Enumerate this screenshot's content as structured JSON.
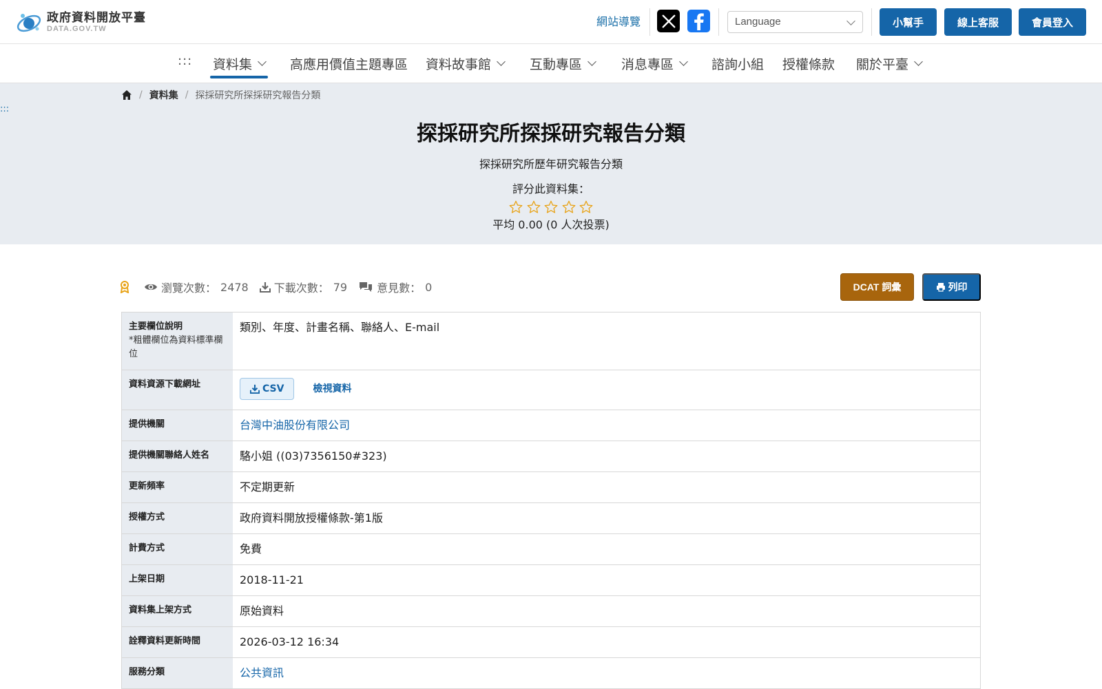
{
  "header": {
    "logo_title": "政府資料開放平臺",
    "logo_subtitle": "DATA.GOV.TW",
    "sitemap_label": "網站導覽",
    "language_placeholder": "Language",
    "helper_label": "小幫手",
    "service_label": "線上客服",
    "login_label": "會員登入"
  },
  "nav": {
    "accesskey": ":::",
    "items": [
      {
        "label": "資料集",
        "dropdown": true,
        "active": true
      },
      {
        "label": "高應用價值主題專區",
        "dropdown": false
      },
      {
        "label": "資料故事館",
        "dropdown": true
      },
      {
        "label": "互動專區",
        "dropdown": true
      },
      {
        "label": "消息專區",
        "dropdown": true
      },
      {
        "label": "諮詢小組",
        "dropdown": false
      },
      {
        "label": "授權條款",
        "dropdown": false
      },
      {
        "label": "關於平臺",
        "dropdown": true
      }
    ]
  },
  "breadcrumb": {
    "separator": "/",
    "section": "資料集",
    "current": "探採研究所探採研究報告分類"
  },
  "side_accesskey": ":::",
  "dataset": {
    "title": "探採研究所探採研究報告分類",
    "description": "探採研究所歷年研究報告分類",
    "rate_label": "評分此資料集：",
    "rating_value": 0,
    "rating_max": 5,
    "rating_summary": "平均 0.00 (0 人次投票)"
  },
  "stats": {
    "views_label": "瀏覽次數：",
    "views": "2478",
    "downloads_label": "下載次數：",
    "downloads": "79",
    "comments_label": "意見數：",
    "comments": "0"
  },
  "actions": {
    "dcat_label": "DCAT 詞彙",
    "print_label": "列印"
  },
  "meta": {
    "fields": {
      "key": "主要欄位說明",
      "note": "*粗體欄位為資料標準欄位",
      "value": "類別、年度、計畫名稱、聯絡人、E-mail"
    },
    "download": {
      "key": "資料資源下載網址",
      "csv_label": "CSV",
      "view_label": "檢視資料"
    },
    "rows": [
      {
        "key": "提供機關",
        "value": "台灣中油股份有限公司",
        "link": true
      },
      {
        "key": "提供機關聯絡人姓名",
        "value": "駱小姐 ((03)7356150#323)",
        "link": false
      },
      {
        "key": "更新頻率",
        "value": "不定期更新",
        "link": false
      },
      {
        "key": "授權方式",
        "value": "政府資料開放授權條款-第1版",
        "link": false
      },
      {
        "key": "計費方式",
        "value": "免費",
        "link": false
      },
      {
        "key": "上架日期",
        "value": "2018-11-21",
        "link": false
      },
      {
        "key": "資料集上架方式",
        "value": "原始資料",
        "link": false
      },
      {
        "key": "詮釋資料更新時間",
        "value": "2026-03-12 16:34",
        "link": false
      },
      {
        "key": "服務分類",
        "value": "公共資訊",
        "link": true
      }
    ]
  },
  "colors": {
    "primary": "#1565a8",
    "dcat": "#a8650d",
    "hero_bg": "#e8ecf1",
    "star": "#e8a317"
  }
}
